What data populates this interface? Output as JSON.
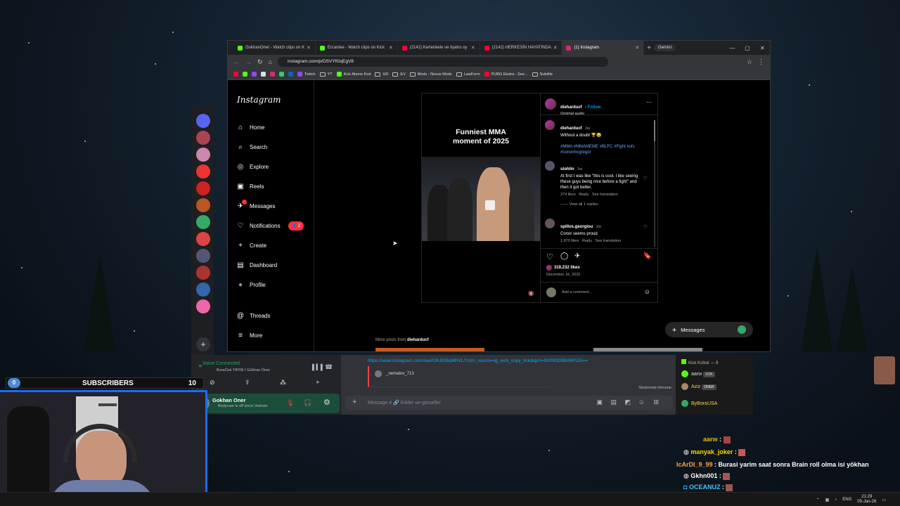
{
  "browser": {
    "tabs": [
      {
        "label": "GokhanOner - Watch clips on K",
        "color": "#53fc18"
      },
      {
        "label": "Ercantee - Watch clips on Kick",
        "color": "#53fc18"
      },
      {
        "label": "(2142) Kertenkele ve tiyatro oy",
        "color": "#ff0033"
      },
      {
        "label": "(2142) HERKESİN HAYATINDA",
        "color": "#ff0033"
      },
      {
        "label": "(1) Instagram",
        "color": "#d62976",
        "active": true
      }
    ],
    "new_tab": "+",
    "gemini": "Gemini",
    "url": "instagram.com/p/DSVYfGqEgV8",
    "bookmarks": [
      "Twitch",
      "YT",
      "Kick Abone Kod",
      "HD",
      "EV",
      "Mods - Nexus Mods",
      "LawForm",
      "PUBG Ekstra - See...",
      "Subtitle"
    ]
  },
  "instagram": {
    "logo": "Instagram",
    "nav": [
      {
        "label": "Home",
        "icon": "home-icon",
        "glyph": "⌂"
      },
      {
        "label": "Search",
        "icon": "search-icon",
        "glyph": "⌕"
      },
      {
        "label": "Explore",
        "icon": "compass-icon",
        "glyph": "◎"
      },
      {
        "label": "Reels",
        "icon": "reels-icon",
        "glyph": "▣"
      },
      {
        "label": "Messages",
        "icon": "messenger-icon",
        "glyph": "✈"
      },
      {
        "label": "Notifications",
        "icon": "heart-icon",
        "glyph": "♡"
      },
      {
        "label": "Create",
        "icon": "plus-icon",
        "glyph": "+"
      },
      {
        "label": "Dashboard",
        "icon": "dashboard-icon",
        "glyph": "▤"
      },
      {
        "label": "Profile",
        "icon": "avatar-icon",
        "glyph": "●"
      },
      {
        "label": "Threads",
        "icon": "threads-icon",
        "glyph": "@"
      },
      {
        "label": "More",
        "icon": "hamburger-icon",
        "glyph": "≡"
      }
    ],
    "notifications_badge": "2",
    "post": {
      "video_title_1": "Funniest MMA",
      "video_title_2": "moment of 2025",
      "author": "dieharducf",
      "follow": "Follow",
      "audio": "Original audio",
      "caption_time": "2w",
      "caption": "Without a doubt 🏆😂",
      "hashtags": "#MMA #MMAMEME #BLFC #Fight #ufc #conormcgregor",
      "comments": [
        {
          "user": "stohlin",
          "time": "1w",
          "text": "At first I was like \"this is cool. I like seeing these guys being nice before a fight\" and then it got better.",
          "likes": "274 likes",
          "reply": "Reply",
          "translate": "See translation",
          "view_replies": "View all 1 replies"
        },
        {
          "user": "spillos.georgiou",
          "time": "2w",
          "text": "Conor seems proud",
          "likes": "1,970 likes",
          "reply": "Reply",
          "translate": "See translation"
        }
      ],
      "like_count": "319,232 likes",
      "date": "December 16, 2025",
      "add_comment_placeholder": "Add a comment..."
    },
    "more_posts_prefix": "More posts from",
    "more_posts_user": "dieharducf",
    "messages_pill": "Messages"
  },
  "discord": {
    "voice_status": "Voice Connected",
    "voice_channel": "BoraÖzk YAYIN / Gökhan Öner",
    "user_name": "Gokhan Oner",
    "user_status": "Bodycam is off since Voitram",
    "link": "https://www.instagram.com/reel/DNJDf6qMRVL/?utm_source=ig_web_copy_link&igsh=MzRlODBiNWFlZA==",
    "chat_user": "_nematov_713",
    "slowmode": "Slowmode immune",
    "message_placeholder": "Message # 🔗 linkler-ve-görseller"
  },
  "kick_side": {
    "title": "Kick Koltuk — 9",
    "users": [
      "aarw",
      "Aziz",
      "ByBoraUSA"
    ],
    "badge_1": "SOK",
    "badge_2": "ONER"
  },
  "stream_overlay": {
    "subs_left": "0",
    "subs_label": "SUBSCRIBERS",
    "subs_goal": "10"
  },
  "kick_chat": [
    {
      "user": "aarw",
      "color": "#e6b800",
      "msg": ""
    },
    {
      "user": "manyak_joker",
      "color": "#ffd700",
      "msg": ""
    },
    {
      "user": "IcArDI_9_99",
      "color": "#ff9f43",
      "msg": "Burasi yarim saat sonra Brain roll olma isi yökhan"
    },
    {
      "user": "Gkhn001",
      "color": "#ffffff",
      "msg": ""
    },
    {
      "user": "OCEANUZ",
      "color": "#3ec7ff",
      "msg": ""
    }
  ],
  "taskbar": {
    "lang": "ENG",
    "time": "21:29",
    "date": "05-Jan-26"
  }
}
